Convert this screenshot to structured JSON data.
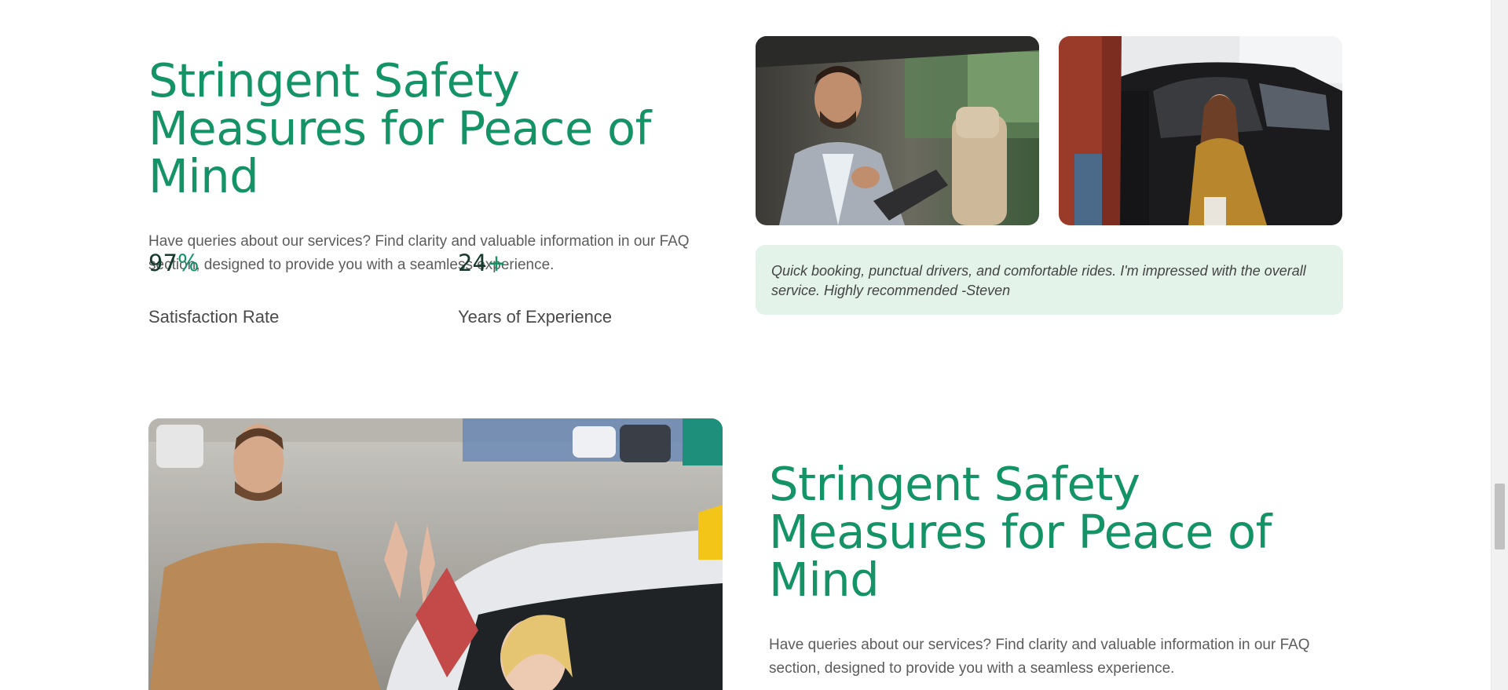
{
  "section1": {
    "heading": "Stringent Safety Measures for Peace of Mind",
    "description": "Have queries about our services? Find clarity and valuable information in our FAQ section, designed to provide you with a seamless experience.",
    "stats": [
      {
        "value": "97",
        "suffix": "%",
        "label": "Satisfaction Rate"
      },
      {
        "value": "24",
        "suffix": "+",
        "label": "Years of Experience"
      }
    ],
    "testimonial": "Quick booking, punctual drivers, and comfortable rides. I'm impressed with the overall service. Highly recommended -Steven"
  },
  "section2": {
    "heading": "Stringent Safety Measures for Peace of Mind",
    "description": "Have queries about our services? Find clarity and valuable information in our FAQ section, designed to provide you with a seamless experience."
  },
  "colors": {
    "accent": "#149466",
    "stat_number": "#163a2c",
    "testimonial_bg": "#e3f3e9"
  }
}
